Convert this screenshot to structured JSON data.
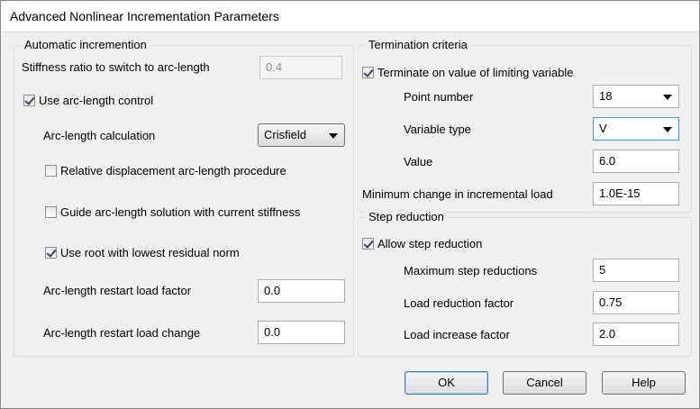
{
  "window": {
    "title": "Advanced Nonlinear Incrementation Parameters"
  },
  "auto": {
    "title": "Automatic incremention",
    "stiffness_label": "Stiffness ratio to switch to arc-length",
    "stiffness_value": "0.4",
    "use_arc_label": "Use arc-length control",
    "use_arc_checked": true,
    "arc_calc_label": "Arc-length calculation",
    "arc_calc_value": "Crisfield",
    "relative_label": "Relative displacement arc-length procedure",
    "relative_checked": false,
    "guide_label": "Guide arc-length solution with current stiffness",
    "guide_checked": false,
    "root_label": "Use root with lowest residual norm",
    "root_checked": true,
    "restart_factor_label": "Arc-length restart load factor",
    "restart_factor_value": "0.0",
    "restart_change_label": "Arc-length restart load change",
    "restart_change_value": "0.0"
  },
  "term": {
    "title": "Termination criteria",
    "terminate_label": "Terminate on value of limiting variable",
    "terminate_checked": true,
    "point_label": "Point number",
    "point_value": "18",
    "vartype_label": "Variable type",
    "vartype_value": "V",
    "value_label": "Value",
    "value_value": "6.0",
    "minchange_label": "Minimum change in incremental load",
    "minchange_value": "1.0E-15"
  },
  "step": {
    "title": "Step reduction",
    "allow_label": "Allow step reduction",
    "allow_checked": true,
    "max_label": "Maximum step reductions",
    "max_value": "5",
    "reduction_label": "Load reduction factor",
    "reduction_value": "0.75",
    "increase_label": "Load increase factor",
    "increase_value": "2.0"
  },
  "buttons": {
    "ok": "OK",
    "cancel": "Cancel",
    "help": "Help"
  }
}
